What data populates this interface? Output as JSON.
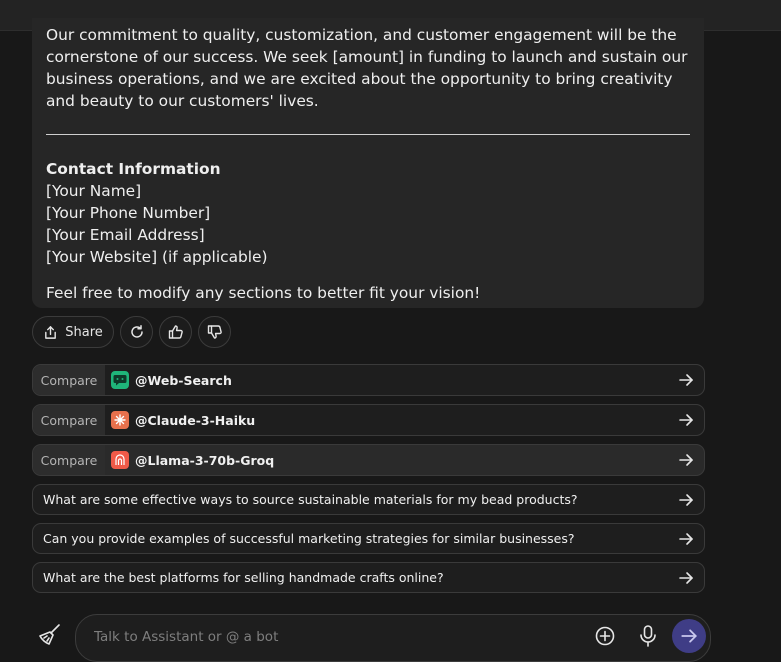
{
  "message": {
    "paragraph": "Our commitment to quality, customization, and customer engagement will be the cornerstone of our success. We seek [amount] in funding to launch and sustain our business operations, and we are excited about the opportunity to bring creativity and beauty to our customers' lives.",
    "contact_title": "Contact Information",
    "contact_lines": [
      "[Your Name]",
      "[Your Phone Number]",
      "[Your Email Address]",
      "[Your Website] (if applicable)"
    ],
    "closing": "Feel free to modify any sections to better fit your vision!"
  },
  "actions": {
    "share_label": "Share"
  },
  "compare": [
    {
      "label": "Compare",
      "bot": "@Web-Search",
      "icon": "web-search-bot-icon",
      "color": "#1fb57a"
    },
    {
      "label": "Compare",
      "bot": "@Claude-3-Haiku",
      "icon": "claude-bot-icon",
      "color": "#e8714d"
    },
    {
      "label": "Compare",
      "bot": "@Llama-3-70b-Groq",
      "icon": "llama-bot-icon",
      "color": "#f05a48"
    }
  ],
  "questions": [
    "What are some effective ways to source sustainable materials for my bead products?",
    "Can you provide examples of successful marketing strategies for similar businesses?",
    "What are the best platforms for selling handmade crafts online?"
  ],
  "composer": {
    "placeholder": "Talk to Assistant or @ a bot"
  },
  "colors": {
    "send_button": "#3f3d86",
    "background": "#181818"
  }
}
